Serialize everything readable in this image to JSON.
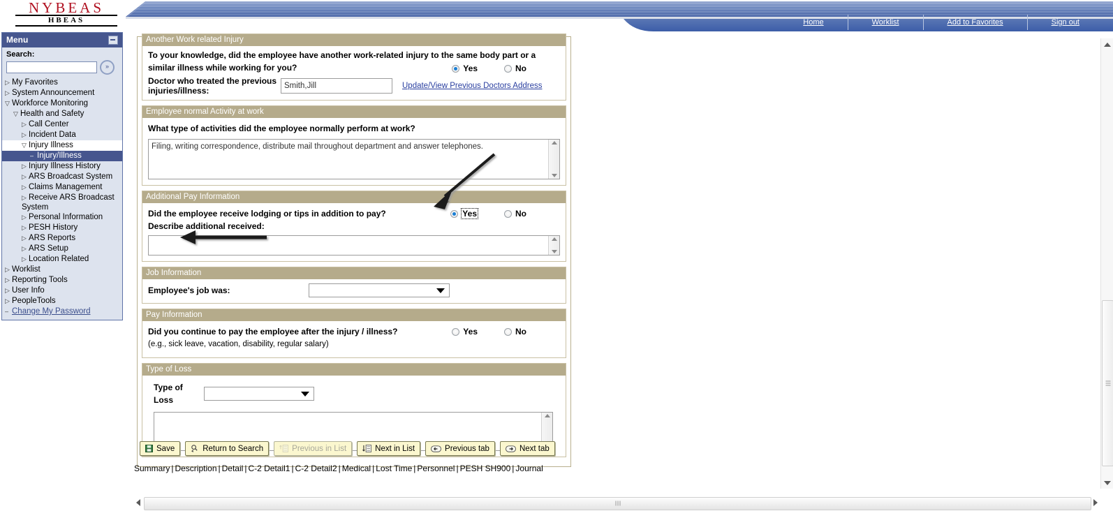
{
  "header": {
    "logo_main": "NYBEAS",
    "logo_sub": "HBEAS",
    "nav": [
      {
        "label": "Home"
      },
      {
        "label": "Worklist"
      },
      {
        "label": "Add to Favorites"
      },
      {
        "label": "Sign out"
      }
    ]
  },
  "sidebar": {
    "title": "Menu",
    "search_label": "Search:",
    "search_value": "",
    "search_placeholder": "",
    "go_icon": "double-chevron-right-icon",
    "items": [
      {
        "label": "My Favorites",
        "level": 0,
        "marker": "collapsed",
        "state": "normal"
      },
      {
        "label": "System Announcement",
        "level": 0,
        "marker": "collapsed",
        "state": "normal"
      },
      {
        "label": "Workforce Monitoring",
        "level": 0,
        "marker": "expanded",
        "state": "normal"
      },
      {
        "label": "Health and Safety",
        "level": 1,
        "marker": "expanded",
        "state": "normal"
      },
      {
        "label": "Call Center",
        "level": 2,
        "marker": "collapsed",
        "state": "normal"
      },
      {
        "label": "Incident Data",
        "level": 2,
        "marker": "collapsed",
        "state": "normal"
      },
      {
        "label": "Injury Illness",
        "level": 2,
        "marker": "expanded",
        "state": "open"
      },
      {
        "label": "Injury/Illness",
        "level": 3,
        "marker": "leaf",
        "state": "selected"
      },
      {
        "label": "Injury Illness History",
        "level": 2,
        "marker": "collapsed",
        "state": "normal"
      },
      {
        "label": "ARS Broadcast System",
        "level": 2,
        "marker": "collapsed",
        "state": "normal"
      },
      {
        "label": "Claims Management",
        "level": 2,
        "marker": "collapsed",
        "state": "normal"
      },
      {
        "label": "Receive ARS Broadcast System",
        "level": 2,
        "marker": "collapsed",
        "state": "wrap"
      },
      {
        "label": "Personal Information",
        "level": 2,
        "marker": "collapsed",
        "state": "normal"
      },
      {
        "label": "PESH History",
        "level": 2,
        "marker": "collapsed",
        "state": "normal"
      },
      {
        "label": "ARS Reports",
        "level": 2,
        "marker": "collapsed",
        "state": "normal"
      },
      {
        "label": "ARS Setup",
        "level": 2,
        "marker": "collapsed",
        "state": "normal"
      },
      {
        "label": "Location Related",
        "level": 2,
        "marker": "collapsed",
        "state": "normal"
      },
      {
        "label": "Worklist",
        "level": 0,
        "marker": "collapsed",
        "state": "normal"
      },
      {
        "label": "Reporting Tools",
        "level": 0,
        "marker": "collapsed",
        "state": "normal"
      },
      {
        "label": "User Info",
        "level": 0,
        "marker": "collapsed",
        "state": "normal"
      },
      {
        "label": "PeopleTools",
        "level": 0,
        "marker": "collapsed",
        "state": "normal"
      },
      {
        "label": "Change My Password",
        "level": 0,
        "marker": "leaf",
        "state": "link"
      }
    ]
  },
  "form": {
    "another_injury": {
      "section_title": "Another Work related Injury",
      "question": "To your knowledge, did the employee have another work-related injury to the same body part or a similar illness while working for you?",
      "yes_label": "Yes",
      "no_label": "No",
      "selected": "Yes",
      "doctor_label": "Doctor who treated the previous injuries/illness:",
      "doctor_value": "Smith,Jill",
      "doctor_link": "Update/View Previous Doctors Address"
    },
    "normal_activity": {
      "section_title": "Employee normal Activity at work",
      "question": "What type of activities did the employee normally perform at  work?",
      "value": "Filing, writing correspondence, distribute mail throughout department and answer telephones."
    },
    "additional_pay": {
      "section_title": "Additional Pay Information",
      "question": "Did the employee receive lodging or tips in addition to pay?",
      "yes_label": "Yes",
      "no_label": "No",
      "selected": "Yes",
      "describe_label": "Describe additional received:",
      "describe_value": ""
    },
    "job_information": {
      "section_title": "Job Information",
      "label": "Employee's job was:",
      "value": "",
      "icon": "chevron-down-icon"
    },
    "pay_information": {
      "section_title": "Pay Information",
      "question": "Did you continue to pay the employee after the injury / illness?",
      "hint": "(e.g., sick leave, vacation, disability, regular salary)",
      "yes_label": "Yes",
      "no_label": "No",
      "selected": ""
    },
    "type_of_loss": {
      "section_title": "Type of Loss",
      "label": "Type of Loss",
      "value": "",
      "notes": "",
      "icon": "chevron-down-icon"
    }
  },
  "toolbar": {
    "buttons": [
      {
        "label": "Save",
        "icon": "save-disk-icon",
        "disabled": false
      },
      {
        "label": "Return to Search",
        "icon": "search-back-icon",
        "disabled": false
      },
      {
        "label": "Previous in List",
        "icon": "up-list-icon",
        "disabled": true
      },
      {
        "label": "Next in List",
        "icon": "down-list-icon",
        "disabled": false
      },
      {
        "label": "Previous tab",
        "icon": "left-arrow-icon",
        "disabled": false
      },
      {
        "label": "Next tab",
        "icon": "right-arrow-icon",
        "disabled": false
      }
    ]
  },
  "tabs": {
    "items": [
      {
        "label": "Summary",
        "current": false
      },
      {
        "label": "Description",
        "current": false
      },
      {
        "label": "Detail",
        "current": false
      },
      {
        "label": "C-2 Detail1",
        "current": false
      },
      {
        "label": "C-2 Detail2",
        "current": true
      },
      {
        "label": "Medical",
        "current": false
      },
      {
        "label": "Lost Time",
        "current": false
      },
      {
        "label": "Personnel",
        "current": false
      },
      {
        "label": "PESH SH900",
        "current": false
      },
      {
        "label": "Journal",
        "current": false
      }
    ],
    "separator": "|"
  },
  "colors": {
    "nav_blue": "#3c5da8",
    "menu_header": "#46568e",
    "section_header": "#b5ab8b",
    "button_yellow": "#fbf7cf",
    "link_blue": "#2a3fa0",
    "logo_red": "#b01020",
    "radio_selected": "#1a7fd4"
  },
  "annotations": [
    {
      "name": "arrow-to-additional-pay-yes",
      "direction": "down-left"
    },
    {
      "name": "arrow-to-describe-field",
      "direction": "left"
    }
  ]
}
